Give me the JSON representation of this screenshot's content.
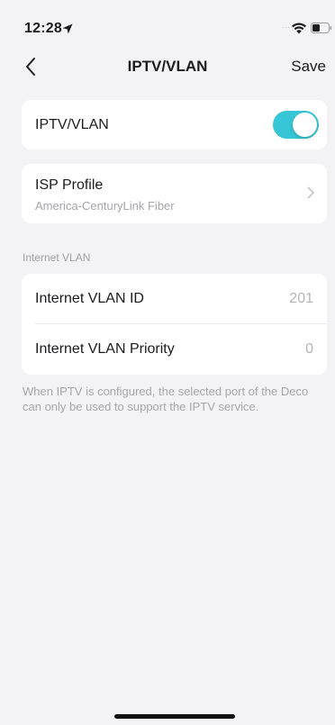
{
  "status_bar": {
    "time": "12:28",
    "signal_dots": "....",
    "icons": [
      "location-arrow-icon",
      "wifi-icon",
      "battery-icon"
    ]
  },
  "nav": {
    "title": "IPTV/VLAN",
    "save_label": "Save",
    "back_icon": "chevron-left-icon"
  },
  "toggle_card": {
    "label": "IPTV/VLAN",
    "enabled": true,
    "accent_color": "#37c6d6"
  },
  "isp_card": {
    "label": "ISP Profile",
    "value": "America-CenturyLink Fiber",
    "chevron_icon": "chevron-right-icon"
  },
  "internet_vlan": {
    "section_title": "Internet VLAN",
    "rows": [
      {
        "label": "Internet VLAN ID",
        "value": "201"
      },
      {
        "label": "Internet VLAN Priority",
        "value": "0"
      }
    ]
  },
  "footnote": "When IPTV is configured, the selected port of the Deco can only be used to support the IPTV service."
}
